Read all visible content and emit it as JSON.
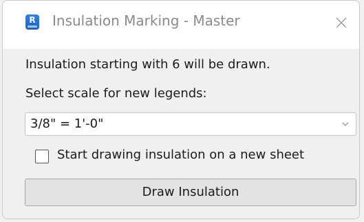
{
  "window": {
    "title": "Insulation Marking - Master",
    "app_icon": "revit-app-icon",
    "app_icon_glyph": "R",
    "close_icon": "close-icon"
  },
  "body": {
    "info_text": "Insulation starting with 6 will be drawn.",
    "scale_prompt": "Select scale for new legends:",
    "scale_dropdown": {
      "selected": "3/8\" = 1'-0\""
    },
    "new_sheet_checkbox": {
      "label": "Start drawing insulation on a new sheet",
      "checked": false
    },
    "draw_button_label": "Draw Insulation"
  },
  "colors": {
    "accent": "#1f62c2",
    "title_text": "#8a8a8a",
    "body_text": "#1b1b1b",
    "button_face": "#e3e3e3"
  }
}
